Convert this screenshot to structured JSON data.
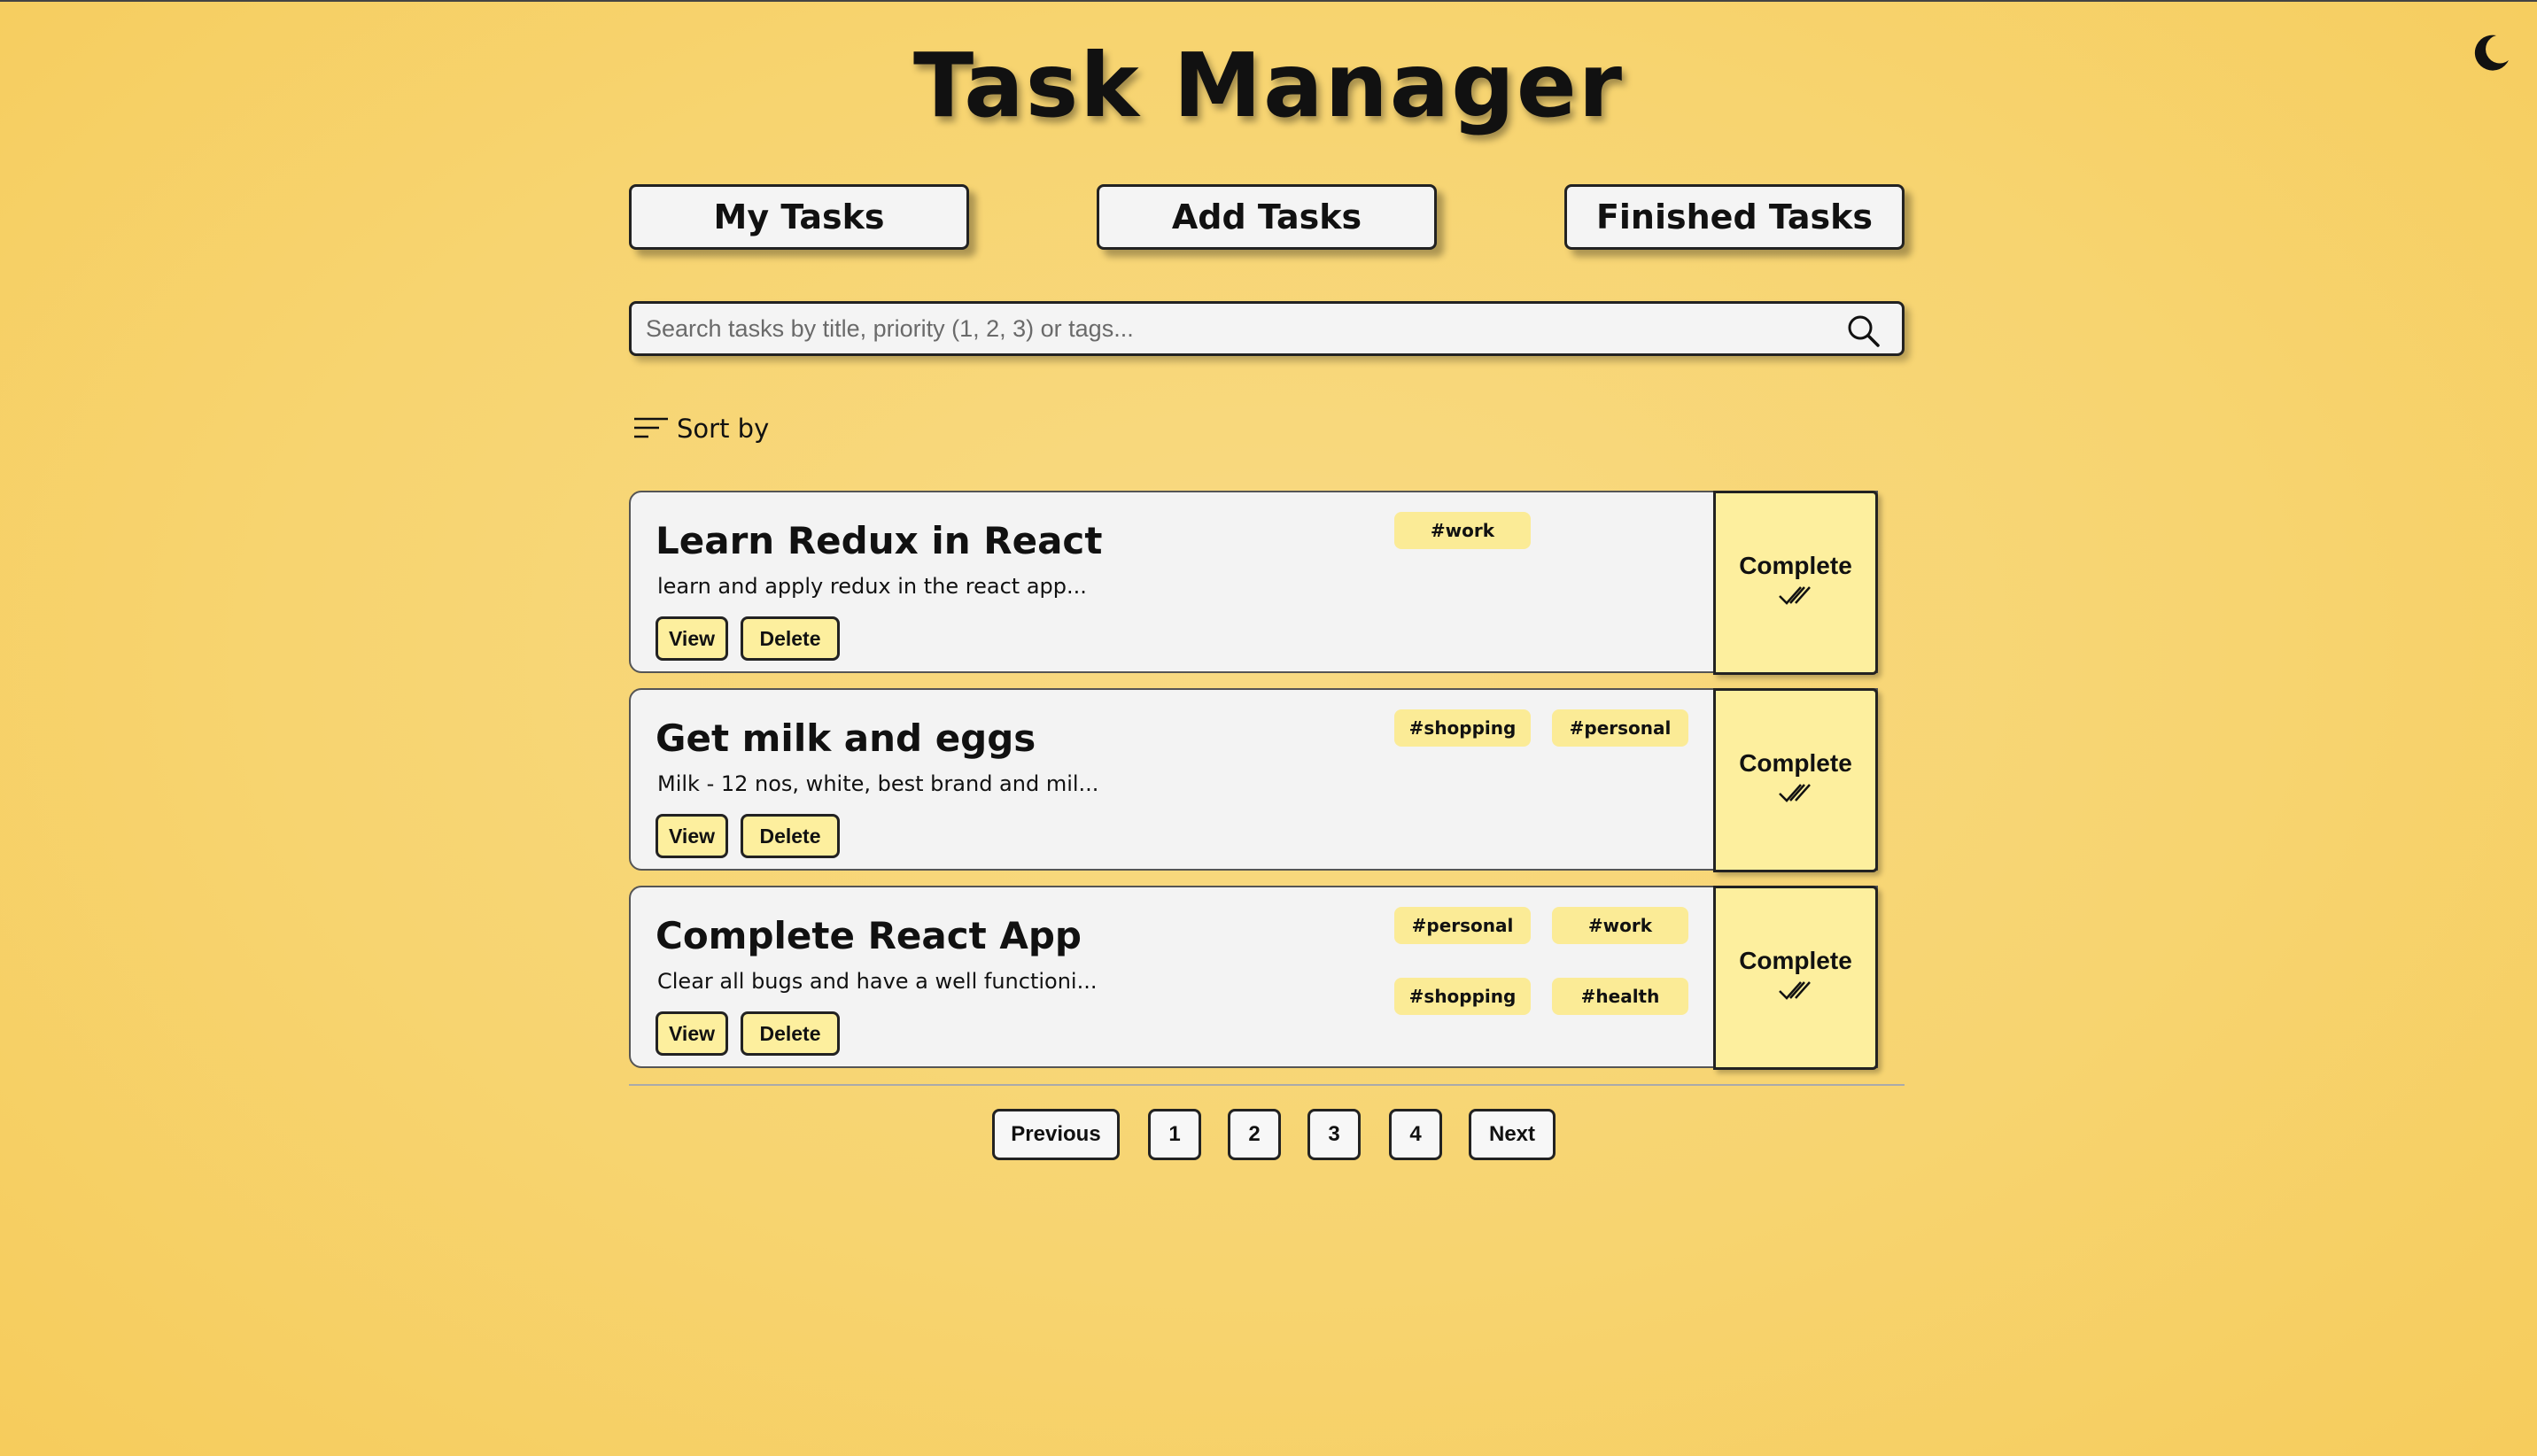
{
  "app": {
    "title": "Task Manager"
  },
  "theme_toggle": {
    "icon": "moon-icon"
  },
  "nav": {
    "my_tasks": "My Tasks",
    "add_tasks": "Add Tasks",
    "finished_tasks": "Finished Tasks"
  },
  "search": {
    "placeholder": "Search tasks by title, priority (1, 2, 3) or tags...",
    "value": "",
    "icon": "search-icon"
  },
  "sort": {
    "label": "Sort by",
    "icon": "sort-lines-icon"
  },
  "tasks": [
    {
      "title": "Learn Redux in React",
      "description": "learn and apply redux in the react app...",
      "tags": [
        "#work"
      ],
      "view_label": "View",
      "delete_label": "Delete",
      "complete_label": "Complete"
    },
    {
      "title": "Get milk and eggs",
      "description": "Milk - 12 nos, white, best brand and mil...",
      "tags": [
        "#shopping",
        "#personal"
      ],
      "view_label": "View",
      "delete_label": "Delete",
      "complete_label": "Complete"
    },
    {
      "title": "Complete React App",
      "description": "Clear all bugs and have a well functioni...",
      "tags": [
        "#personal",
        "#work",
        "#shopping",
        "#health"
      ],
      "view_label": "View",
      "delete_label": "Delete",
      "complete_label": "Complete"
    }
  ],
  "pagination": {
    "previous": "Previous",
    "pages": [
      "1",
      "2",
      "3",
      "4"
    ],
    "next": "Next"
  },
  "colors": {
    "background": "#f7d470",
    "accent": "#fdef9e",
    "tag": "#fbeb96",
    "card": "#f3f3f3"
  }
}
